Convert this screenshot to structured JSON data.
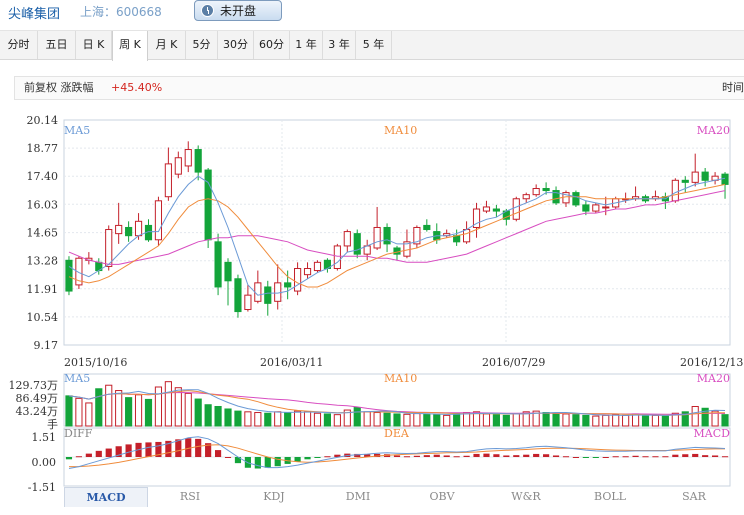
{
  "header": {
    "stock_name": "尖峰集团",
    "stock_code": "上海：600668",
    "status_label": "未开盘"
  },
  "tabs": [
    "分时",
    "五日",
    "日 K",
    "周 K",
    "月 K",
    "5分",
    "30分",
    "60分",
    "1 年",
    "3 年",
    "5 年"
  ],
  "active_tab": "周 K",
  "info": {
    "adjust_label": "前复权 涨跌幅",
    "change_value": "+45.40%",
    "time_label": "时间"
  },
  "colors": {
    "up": "#c4202a",
    "down": "#13a43a",
    "ma5": "#6b9ad6",
    "ma10": "#f08c3c",
    "ma20": "#d84ec1"
  },
  "chart_data": [
    {
      "type": "candlestick",
      "title": "",
      "legend": [
        "MA5",
        "MA10",
        "MA20"
      ],
      "y_ticks": [
        "20.14",
        "18.77",
        "17.40",
        "16.03",
        "14.65",
        "13.28",
        "11.91",
        "10.54",
        "9.17"
      ],
      "ylim": [
        9.17,
        20.14
      ],
      "x_ticks": [
        "2015/10/16",
        "2016/03/11",
        "2016/07/29",
        "2016/12/13"
      ],
      "candles": [
        [
          13.3,
          11.8,
          13.5,
          11.6
        ],
        [
          12.1,
          13.4,
          13.5,
          11.9
        ],
        [
          13.3,
          13.4,
          13.7,
          13.1
        ],
        [
          13.2,
          12.8,
          13.4,
          12.6
        ],
        [
          13.0,
          14.8,
          15.0,
          12.8
        ],
        [
          14.6,
          15.0,
          16.1,
          14.1
        ],
        [
          14.9,
          14.5,
          15.2,
          14.2
        ],
        [
          14.5,
          15.2,
          15.6,
          14.3
        ],
        [
          15.0,
          14.3,
          15.3,
          14.2
        ],
        [
          14.3,
          16.2,
          16.4,
          14.0
        ],
        [
          16.4,
          18.0,
          18.8,
          16.2
        ],
        [
          17.5,
          18.3,
          18.6,
          17.3
        ],
        [
          17.9,
          18.7,
          19.1,
          17.6
        ],
        [
          18.7,
          17.6,
          18.9,
          17.2
        ],
        [
          17.7,
          14.3,
          17.8,
          13.9
        ],
        [
          14.2,
          12.0,
          14.6,
          11.6
        ],
        [
          13.2,
          12.3,
          13.4,
          11.1
        ],
        [
          12.4,
          10.8,
          12.6,
          10.5
        ],
        [
          10.9,
          11.6,
          12.1,
          10.8
        ],
        [
          11.3,
          12.2,
          12.8,
          11.2
        ],
        [
          12.0,
          11.2,
          12.3,
          10.6
        ],
        [
          11.3,
          12.2,
          13.1,
          10.9
        ],
        [
          12.2,
          12.0,
          12.8,
          11.4
        ],
        [
          11.8,
          12.9,
          13.2,
          11.6
        ],
        [
          12.6,
          12.9,
          13.2,
          12.4
        ],
        [
          12.8,
          13.2,
          13.3,
          12.7
        ],
        [
          13.3,
          12.9,
          13.4,
          12.7
        ],
        [
          12.9,
          14.0,
          14.1,
          12.8
        ],
        [
          14.0,
          14.7,
          14.8,
          13.7
        ],
        [
          14.6,
          13.6,
          14.8,
          13.4
        ],
        [
          13.6,
          14.0,
          14.3,
          13.3
        ],
        [
          13.9,
          14.9,
          15.9,
          13.8
        ],
        [
          14.9,
          14.1,
          15.1,
          13.7
        ],
        [
          13.9,
          13.6,
          14.0,
          13.3
        ],
        [
          13.5,
          14.2,
          14.8,
          13.4
        ],
        [
          14.1,
          14.9,
          15.0,
          13.9
        ],
        [
          15.0,
          14.8,
          15.3,
          14.7
        ],
        [
          14.7,
          14.3,
          15.1,
          14.1
        ],
        [
          14.5,
          14.6,
          14.8,
          14.4
        ],
        [
          14.5,
          14.2,
          14.8,
          14.0
        ],
        [
          14.2,
          14.8,
          15.2,
          14.1
        ],
        [
          14.9,
          15.8,
          16.1,
          14.4
        ],
        [
          15.7,
          15.9,
          16.2,
          15.6
        ],
        [
          15.8,
          15.7,
          16.0,
          15.4
        ],
        [
          15.7,
          15.3,
          15.8,
          15.0
        ],
        [
          15.3,
          16.3,
          16.4,
          15.2
        ],
        [
          16.3,
          16.5,
          16.6,
          16.1
        ],
        [
          16.5,
          16.8,
          17.0,
          16.4
        ],
        [
          16.8,
          16.7,
          17.1,
          16.5
        ],
        [
          16.7,
          16.1,
          16.9,
          16.0
        ],
        [
          16.1,
          16.6,
          16.7,
          15.9
        ],
        [
          16.6,
          16.0,
          16.7,
          15.9
        ],
        [
          16.0,
          15.7,
          16.2,
          15.5
        ],
        [
          15.7,
          16.0,
          16.1,
          15.6
        ],
        [
          15.9,
          15.9,
          16.4,
          15.5
        ],
        [
          15.9,
          16.3,
          16.4,
          15.8
        ],
        [
          16.3,
          16.3,
          16.6,
          16.1
        ],
        [
          16.3,
          16.4,
          16.9,
          16.2
        ],
        [
          16.4,
          16.2,
          16.5,
          16.1
        ],
        [
          16.3,
          16.4,
          16.7,
          16.2
        ],
        [
          16.4,
          16.2,
          16.6,
          15.8
        ],
        [
          16.2,
          17.2,
          17.3,
          16.1
        ],
        [
          17.2,
          17.1,
          17.4,
          16.6
        ],
        [
          17.1,
          17.6,
          18.5,
          16.9
        ],
        [
          17.6,
          17.2,
          17.8,
          16.9
        ],
        [
          17.2,
          17.4,
          17.6,
          17.0
        ],
        [
          17.5,
          17.0,
          17.6,
          16.3
        ]
      ],
      "ma5": [
        13.0,
        12.7,
        12.5,
        12.8,
        13.1,
        13.6,
        14.1,
        14.5,
        14.7,
        14.7,
        15.6,
        16.4,
        17.0,
        17.4,
        17.1,
        16.1,
        14.9,
        13.5,
        12.1,
        11.6,
        11.7,
        11.7,
        11.8,
        12.1,
        12.4,
        12.7,
        12.9,
        13.2,
        13.7,
        13.8,
        14.0,
        14.2,
        14.3,
        14.1,
        14.1,
        14.2,
        14.4,
        14.5,
        14.5,
        14.6,
        14.8,
        15.1,
        15.3,
        15.4,
        15.7,
        15.9,
        16.1,
        16.3,
        16.6,
        16.6,
        16.5,
        16.4,
        16.2,
        16.1,
        16.0,
        16.1,
        16.2,
        16.3,
        16.3,
        16.3,
        16.3,
        16.6,
        16.8,
        17.0,
        17.1,
        17.2,
        17.3
      ],
      "ma10": [
        12.5,
        12.3,
        12.2,
        12.3,
        12.5,
        12.8,
        13.1,
        13.4,
        13.7,
        14.0,
        14.6,
        15.3,
        15.9,
        16.2,
        16.3,
        16.2,
        15.9,
        15.4,
        14.8,
        14.2,
        13.6,
        13.0,
        12.5,
        12.2,
        12.0,
        12.0,
        12.2,
        12.5,
        12.8,
        13.0,
        13.2,
        13.4,
        13.6,
        13.7,
        13.8,
        13.9,
        14.1,
        14.3,
        14.4,
        14.5,
        14.6,
        14.8,
        15.0,
        15.2,
        15.4,
        15.6,
        15.8,
        16.0,
        16.2,
        16.3,
        16.4,
        16.4,
        16.4,
        16.3,
        16.3,
        16.3,
        16.3,
        16.3,
        16.3,
        16.3,
        16.4,
        16.5,
        16.6,
        16.7,
        16.8,
        16.9,
        17.0
      ],
      "ma20": [
        13.7,
        13.5,
        13.3,
        13.2,
        13.1,
        13.1,
        13.2,
        13.3,
        13.4,
        13.5,
        13.6,
        13.8,
        14.0,
        14.2,
        14.3,
        14.4,
        14.4,
        14.5,
        14.5,
        14.5,
        14.4,
        14.3,
        14.2,
        14.0,
        13.8,
        13.7,
        13.6,
        13.5,
        13.5,
        13.5,
        13.5,
        13.4,
        13.4,
        13.3,
        13.2,
        13.2,
        13.2,
        13.3,
        13.4,
        13.5,
        13.6,
        13.8,
        14.0,
        14.2,
        14.4,
        14.6,
        14.8,
        15.0,
        15.2,
        15.3,
        15.4,
        15.5,
        15.6,
        15.6,
        15.7,
        15.8,
        15.8,
        15.9,
        16.0,
        16.0,
        16.1,
        16.2,
        16.3,
        16.4,
        16.5,
        16.6,
        16.7
      ]
    },
    {
      "type": "bar",
      "legend": [
        "MA5",
        "MA10",
        "MA20"
      ],
      "y_ticks": [
        "129.73万",
        "86.49万",
        "43.24万"
      ],
      "unit_label": "手",
      "ylim": [
        0,
        129.73
      ],
      "volumes": [
        85,
        78,
        65,
        105,
        115,
        100,
        80,
        88,
        75,
        110,
        125,
        108,
        92,
        76,
        60,
        55,
        48,
        42,
        40,
        38,
        36,
        40,
        38,
        42,
        40,
        36,
        34,
        32,
        45,
        52,
        40,
        38,
        36,
        34,
        33,
        35,
        34,
        32,
        30,
        36,
        38,
        40,
        34,
        32,
        30,
        35,
        40,
        42,
        38,
        36,
        34,
        32,
        30,
        28,
        30,
        32,
        30,
        34,
        28,
        30,
        28,
        36,
        40,
        55,
        50,
        42,
        32
      ]
    },
    {
      "type": "bar",
      "legend": [
        "DIFF",
        "DEA",
        "MACD"
      ],
      "y_ticks": [
        "1.51",
        "0.00",
        "-1.51"
      ],
      "ylim": [
        -1.51,
        1.51
      ],
      "macd": [
        -0.15,
        0.05,
        0.22,
        0.4,
        0.55,
        0.7,
        0.82,
        0.92,
        0.95,
        0.98,
        1.05,
        1.15,
        1.22,
        1.18,
        0.9,
        0.45,
        0.0,
        -0.4,
        -0.7,
        -0.75,
        -0.7,
        -0.6,
        -0.45,
        -0.3,
        -0.15,
        -0.05,
        0.05,
        0.15,
        0.22,
        0.2,
        0.18,
        0.2,
        0.18,
        0.1,
        0.05,
        0.08,
        0.12,
        0.15,
        0.1,
        0.05,
        0.08,
        0.2,
        0.22,
        0.18,
        0.1,
        0.12,
        0.15,
        0.2,
        0.18,
        0.1,
        0.05,
        0.0,
        -0.05,
        -0.05,
        0.0,
        0.05,
        0.05,
        0.08,
        0.05,
        0.05,
        0.05,
        0.15,
        0.18,
        0.2,
        0.12,
        0.1,
        0.05
      ],
      "diff": [
        -0.6,
        -0.5,
        -0.35,
        -0.2,
        -0.05,
        0.1,
        0.25,
        0.38,
        0.5,
        0.58,
        0.7,
        0.85,
        1.0,
        1.05,
        0.95,
        0.7,
        0.35,
        0.0,
        -0.3,
        -0.45,
        -0.55,
        -0.55,
        -0.5,
        -0.42,
        -0.32,
        -0.22,
        -0.12,
        -0.02,
        0.08,
        0.12,
        0.15,
        0.2,
        0.22,
        0.2,
        0.18,
        0.2,
        0.24,
        0.28,
        0.28,
        0.26,
        0.28,
        0.36,
        0.42,
        0.44,
        0.42,
        0.44,
        0.48,
        0.54,
        0.56,
        0.52,
        0.48,
        0.42,
        0.36,
        0.32,
        0.3,
        0.3,
        0.3,
        0.32,
        0.32,
        0.32,
        0.32,
        0.4,
        0.45,
        0.5,
        0.48,
        0.47,
        0.44
      ],
      "dea": [
        -0.5,
        -0.5,
        -0.47,
        -0.42,
        -0.36,
        -0.28,
        -0.18,
        -0.08,
        0.02,
        0.12,
        0.22,
        0.33,
        0.45,
        0.55,
        0.62,
        0.64,
        0.58,
        0.46,
        0.3,
        0.15,
        0.0,
        -0.12,
        -0.2,
        -0.25,
        -0.27,
        -0.26,
        -0.22,
        -0.17,
        -0.11,
        -0.05,
        0.0,
        0.05,
        0.09,
        0.12,
        0.14,
        0.16,
        0.18,
        0.2,
        0.22,
        0.23,
        0.24,
        0.26,
        0.3,
        0.33,
        0.35,
        0.37,
        0.39,
        0.42,
        0.45,
        0.46,
        0.46,
        0.45,
        0.43,
        0.4,
        0.38,
        0.36,
        0.35,
        0.34,
        0.34,
        0.34,
        0.34,
        0.35,
        0.37,
        0.39,
        0.41,
        0.42,
        0.42
      ]
    }
  ],
  "indicator_tabs": [
    "MACD",
    "RSI",
    "KDJ",
    "DMI",
    "OBV",
    "W&R",
    "BOLL",
    "SAR"
  ],
  "active_indicator": "MACD"
}
